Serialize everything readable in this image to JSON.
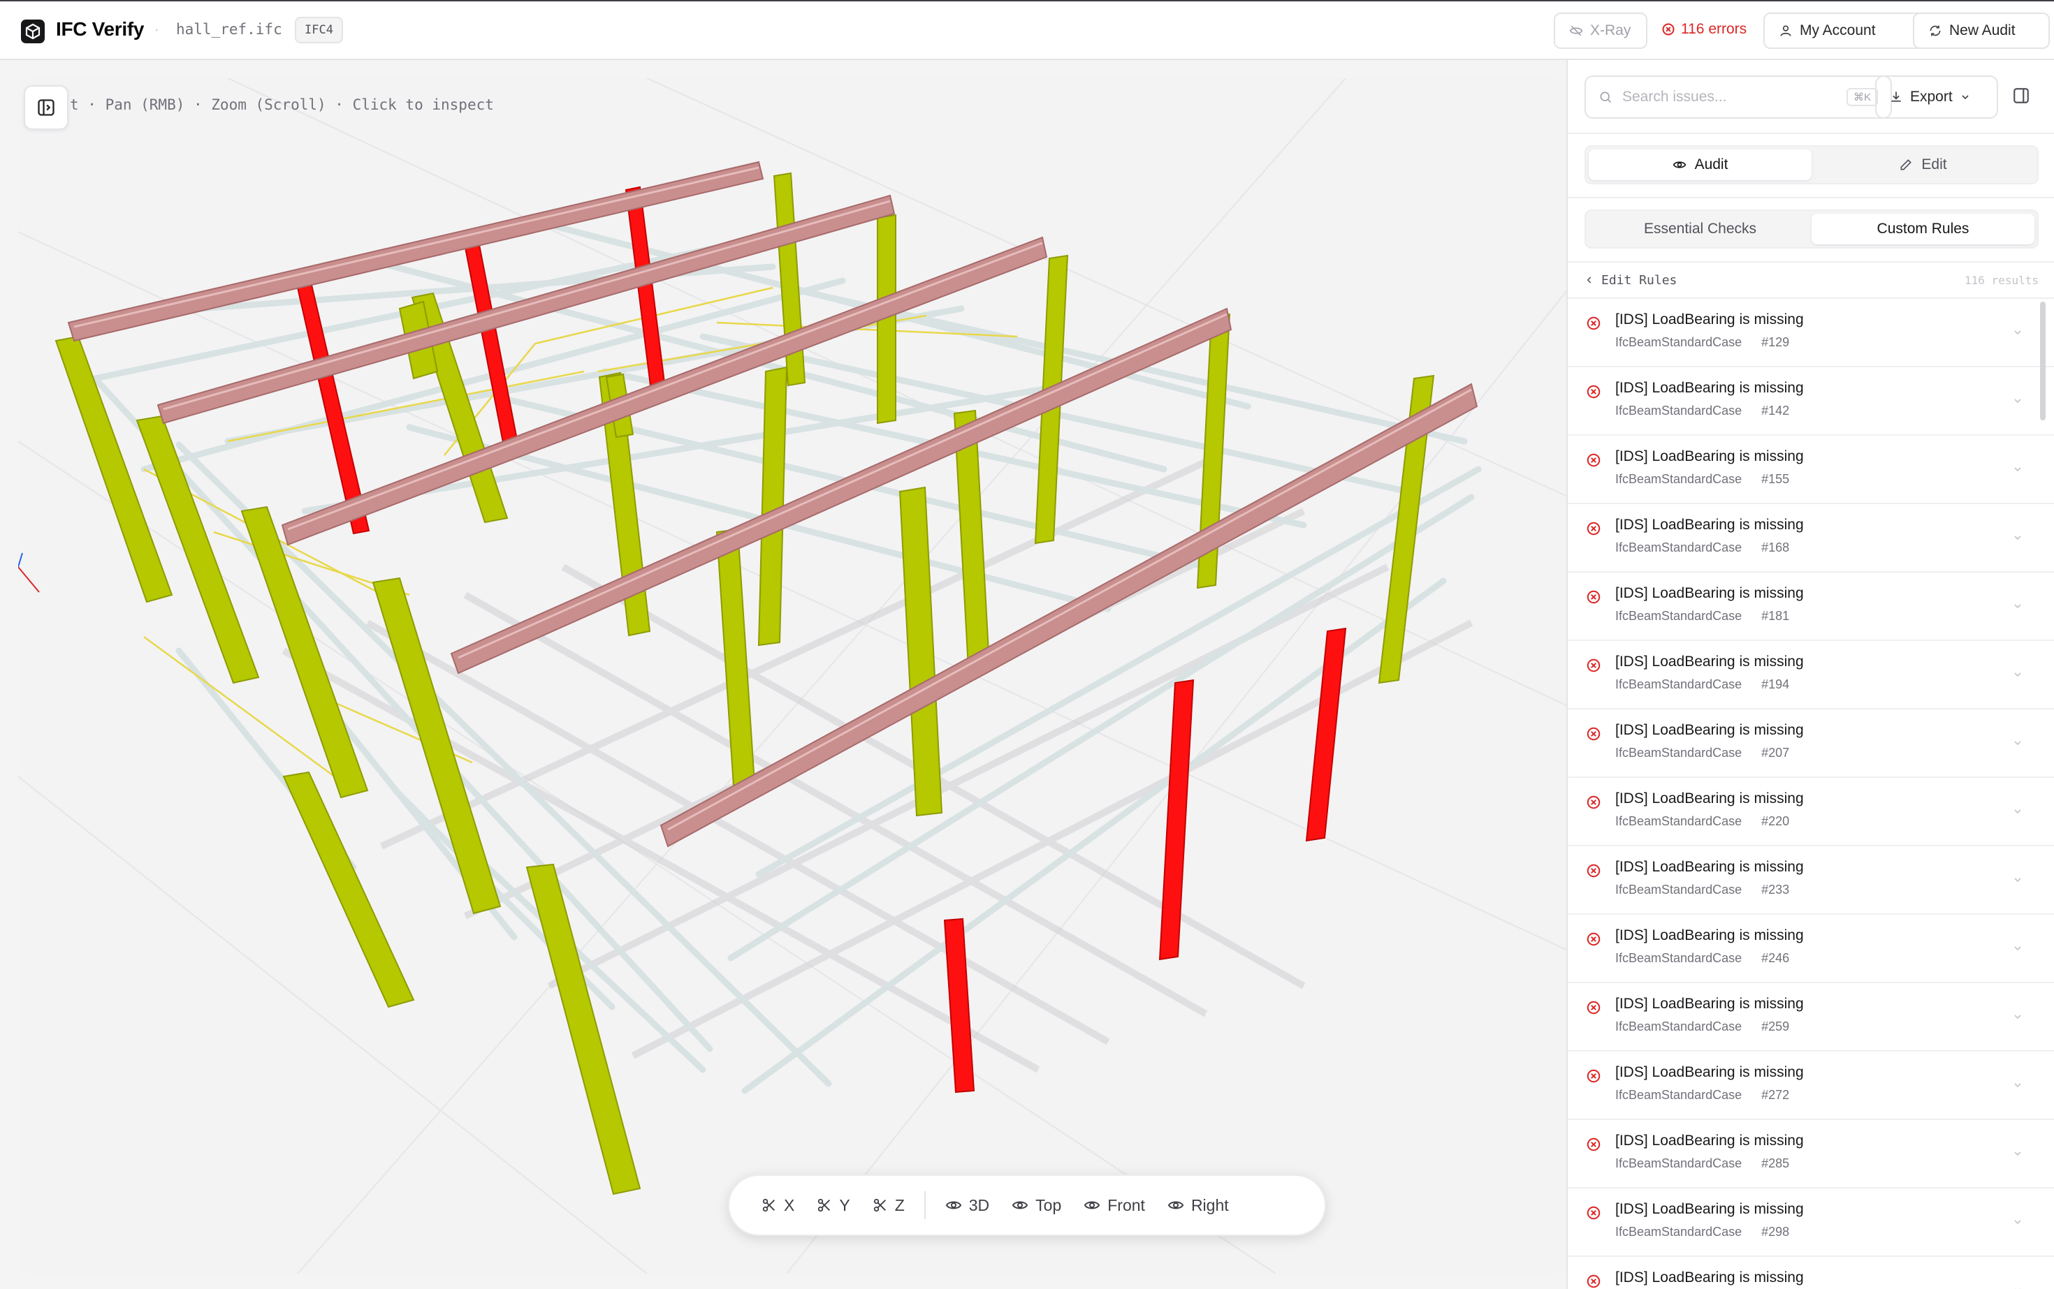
{
  "header": {
    "app_title": "IFC Verify",
    "file_name": "hall_ref.ifc",
    "schema": "IFC4",
    "xray_label": "X-Ray",
    "errors_label": "116 errors",
    "account_label": "My Account",
    "new_audit_label": "New Audit"
  },
  "viewer": {
    "hint": "t · Pan (RMB) · Zoom (Scroll) · Click to inspect",
    "colors": {
      "beam": "#c98e8e",
      "column_ok": "#b5c800",
      "column_error": "#ff1010",
      "purlin": "#d8e2e2",
      "bracing": "#e8d84a"
    }
  },
  "toolbar": {
    "clip_x": "X",
    "clip_y": "Y",
    "clip_z": "Z",
    "view_3d": "3D",
    "view_top": "Top",
    "view_front": "Front",
    "view_right": "Right"
  },
  "panel": {
    "search_placeholder": "Search issues...",
    "search_shortcut": "⌘K",
    "export_label": "Export",
    "mode_tabs": {
      "audit": "Audit",
      "edit": "Edit",
      "active": "audit"
    },
    "check_tabs": {
      "essential": "Essential Checks",
      "custom": "Custom Rules",
      "active": "custom"
    },
    "edit_rules_label": "Edit Rules",
    "results_count": "116 results",
    "issues": [
      {
        "title": "[IDS] LoadBearing is missing",
        "type": "IfcBeamStandardCase",
        "id": "#129"
      },
      {
        "title": "[IDS] LoadBearing is missing",
        "type": "IfcBeamStandardCase",
        "id": "#142"
      },
      {
        "title": "[IDS] LoadBearing is missing",
        "type": "IfcBeamStandardCase",
        "id": "#155"
      },
      {
        "title": "[IDS] LoadBearing is missing",
        "type": "IfcBeamStandardCase",
        "id": "#168"
      },
      {
        "title": "[IDS] LoadBearing is missing",
        "type": "IfcBeamStandardCase",
        "id": "#181"
      },
      {
        "title": "[IDS] LoadBearing is missing",
        "type": "IfcBeamStandardCase",
        "id": "#194"
      },
      {
        "title": "[IDS] LoadBearing is missing",
        "type": "IfcBeamStandardCase",
        "id": "#207"
      },
      {
        "title": "[IDS] LoadBearing is missing",
        "type": "IfcBeamStandardCase",
        "id": "#220"
      },
      {
        "title": "[IDS] LoadBearing is missing",
        "type": "IfcBeamStandardCase",
        "id": "#233"
      },
      {
        "title": "[IDS] LoadBearing is missing",
        "type": "IfcBeamStandardCase",
        "id": "#246"
      },
      {
        "title": "[IDS] LoadBearing is missing",
        "type": "IfcBeamStandardCase",
        "id": "#259"
      },
      {
        "title": "[IDS] LoadBearing is missing",
        "type": "IfcBeamStandardCase",
        "id": "#272"
      },
      {
        "title": "[IDS] LoadBearing is missing",
        "type": "IfcBeamStandardCase",
        "id": "#285"
      },
      {
        "title": "[IDS] LoadBearing is missing",
        "type": "IfcBeamStandardCase",
        "id": "#298"
      },
      {
        "title": "[IDS] LoadBearing is missing",
        "type": "",
        "id": ""
      }
    ]
  }
}
